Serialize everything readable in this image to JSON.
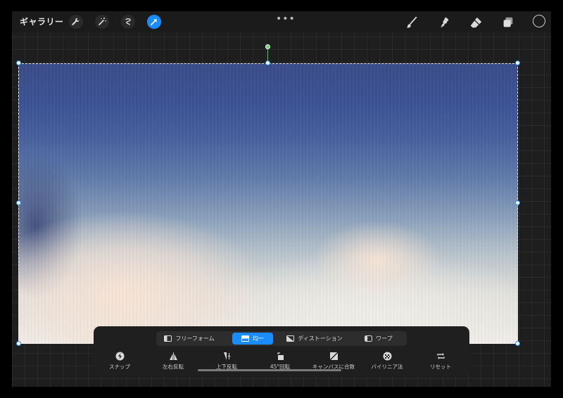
{
  "topbar": {
    "gallery_label": "ギャラリー",
    "left_icons": [
      "wrench-icon",
      "magic-wand-icon",
      "selection-icon",
      "transform-arrow-icon"
    ],
    "more_label": "•••",
    "right_tools": [
      "brush-icon",
      "smudge-icon",
      "eraser-icon",
      "layers-icon"
    ],
    "current_color": "#1e1e1e"
  },
  "transform": {
    "modes": [
      {
        "label": "フリーフォーム",
        "icon": "freeform-icon",
        "active": false
      },
      {
        "label": "均一",
        "icon": "uniform-icon",
        "active": true
      },
      {
        "label": "ディストーション",
        "icon": "distort-icon",
        "active": false
      },
      {
        "label": "ワープ",
        "icon": "warp-icon",
        "active": false
      }
    ],
    "actions": [
      {
        "label": "スナップ",
        "icon": "snap-icon"
      },
      {
        "label": "左右反転",
        "icon": "flip-horizontal-icon"
      },
      {
        "label": "上下反転",
        "icon": "flip-vertical-icon"
      },
      {
        "label": "45°回転",
        "icon": "rotate-45-icon"
      },
      {
        "label": "キャンバスに合致",
        "icon": "fit-canvas-icon"
      },
      {
        "label": "バイリニア法",
        "icon": "bilinear-icon"
      },
      {
        "label": "リセット",
        "icon": "reset-icon"
      }
    ]
  },
  "colors": {
    "accent": "#1a8cff",
    "rotation_handle": "#5ae06a"
  }
}
